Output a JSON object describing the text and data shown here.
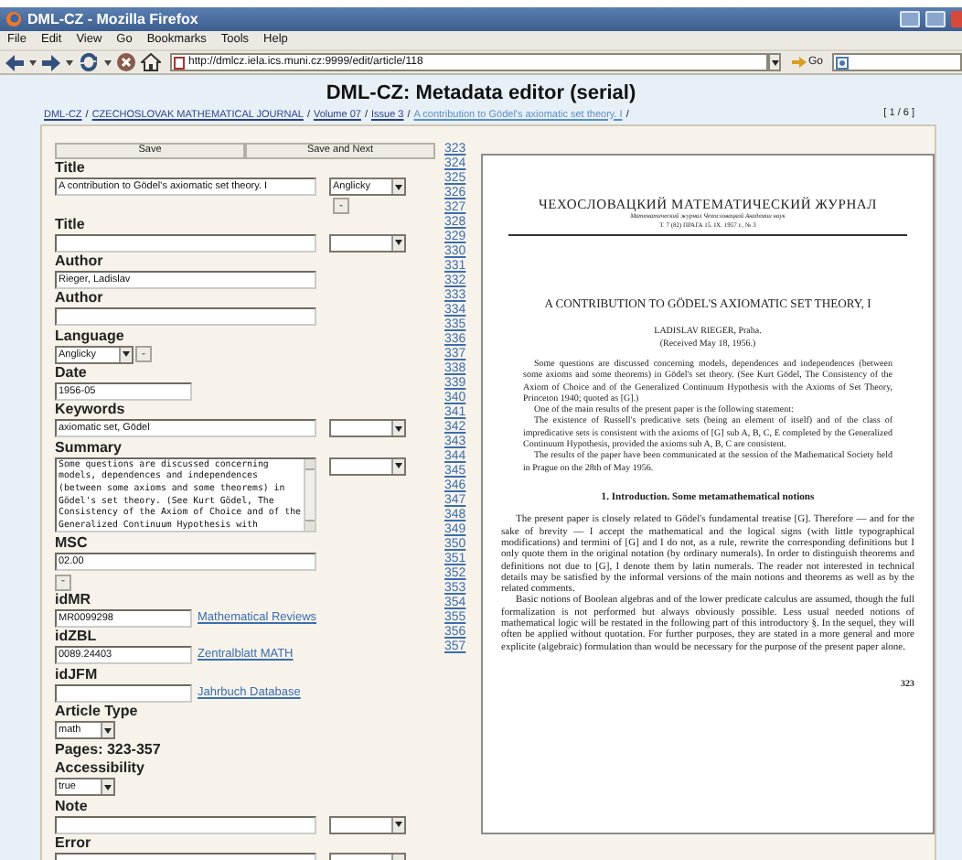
{
  "window": {
    "title": "DML-CZ - Mozilla Firefox"
  },
  "menu": [
    "File",
    "Edit",
    "View",
    "Go",
    "Bookmarks",
    "Tools",
    "Help"
  ],
  "toolbar": {
    "url": "http://dmlcz.iela.ics.muni.cz:9999/edit/article/118",
    "go": "Go"
  },
  "page": {
    "heading": "DML-CZ: Metadata editor (serial)",
    "breadcrumbs": [
      {
        "text": "DML-CZ",
        "visited": false
      },
      {
        "text": "CZECHOSLOVAK MATHEMATICAL JOURNAL",
        "visited": false
      },
      {
        "text": "Volume 07",
        "visited": false
      },
      {
        "text": "Issue 3",
        "visited": false
      },
      {
        "text": "A contribution to Gödel's axiomatic set theory. I",
        "visited": true
      }
    ],
    "breadcrumb_separator": "/",
    "pager": "[ 1 / 6 ]"
  },
  "buttons": [
    "Save",
    "Save and Next"
  ],
  "fields": [
    {
      "label": "Title",
      "kind": "text-lang",
      "value": "A contribution to Gödel's axiomatic set theory. I",
      "language": "Anglicky",
      "remove": "-"
    },
    {
      "label": "Title",
      "kind": "text-lang"
    },
    {
      "label": "Author",
      "kind": "text",
      "value": "Rieger, Ladislav"
    },
    {
      "label": "Author",
      "kind": "text"
    },
    {
      "label": "Language",
      "kind": "select",
      "value": "Anglicky",
      "remove": "-"
    },
    {
      "label": "Date",
      "kind": "short",
      "value": "1956-05"
    },
    {
      "label": "Keywords",
      "kind": "text-lang",
      "value": "axiomatic set, Gödel"
    },
    {
      "label": "Summary",
      "kind": "textarea-lang",
      "value": "Some questions are discussed concerning models, dependences and independences (between some axioms and some theorems) in Gödel's set theory. (See Kurt Gödel, The Consistency of the Axiom of Choice and of the Generalized Continuum Hypothesis with"
    },
    {
      "label": "MSC",
      "kind": "text",
      "value": "02.00",
      "remove": "-"
    },
    {
      "label": "idMR",
      "kind": "short-link",
      "value": "MR0099298",
      "link": "Mathematical Reviews"
    },
    {
      "label": "idZBL",
      "kind": "short-link",
      "value": "0089.24403",
      "link": "Zentralblatt MATH"
    },
    {
      "label": "idJFM",
      "kind": "short-link",
      "link": "Jahrbuch Database"
    },
    {
      "label": "Article Type",
      "kind": "select-small",
      "value": "math"
    },
    {
      "label": "Pages: 323-357",
      "kind": "static"
    },
    {
      "label": "Accessibility",
      "kind": "select-small",
      "value": "true"
    },
    {
      "label": "Note",
      "kind": "text-lang"
    },
    {
      "label": "Error",
      "kind": "text-lang"
    }
  ],
  "page_numbers": [
    "323",
    "324",
    "325",
    "326",
    "327",
    "328",
    "329",
    "330",
    "331",
    "332",
    "333",
    "334",
    "335",
    "336",
    "337",
    "338",
    "339",
    "340",
    "341",
    "342",
    "343",
    "344",
    "345",
    "346",
    "347",
    "348",
    "349",
    "350",
    "351",
    "352",
    "353",
    "354",
    "355",
    "356",
    "357"
  ],
  "document": {
    "journal": "ЧЕХОСЛОВАЦКИЙ МАТЕМАТИЧЕСКИЙ ЖУРНАЛ",
    "journal_subtitle": "Математический журнал Чехословацкой Академии наук",
    "issue": "Т. 7 (82) ПРАГА 15. IX. 1957 г., № 3",
    "title": "A CONTRIBUTION TO GÖDEL'S AXIOMATIC SET THEORY, I",
    "author": "LADISLAV RIEGER, Praha.",
    "received": "(Received May 18, 1956.)",
    "abstract": [
      "Some questions are discussed concerning models, dependences and independences (between some axioms and some theorems) in Gödel's set theory. (See Kurt Gödel, The Consistency of the Axiom of Choice and of the Generalized Continuum Hypothesis with the Axioms of Set Theory, Princeton 1940; quoted as [G].)",
      "One of the main results of the present paper is the following statement:",
      "The existence of Russell's predicative sets (being an element of itself) and of the class of impredicative sets is consistent with the axioms of [G] sub A, B, C, E completed by the Generalized Continuum Hypothesis, provided the axioms sub A, B, C are consistent.",
      "The results of the paper have been communicated at the session of the Mathematical Society held in Prague on the 28th of May 1956."
    ],
    "section": "1. Introduction. Some metamathematical notions",
    "body": [
      "The present paper is closely related to Gödel's fundamental treatise [G]. Therefore — and for the sake of brevity — I accept the mathematical and the logical signs (with little typographical modifications) and termini of [G] and I do not, as a rule, rewrite the corresponding definitions but I only quote them in the original notation (by ordinary numerals). In order to distinguish theorems and definitions not due to [G], I denote them by latin numerals. The reader not interested in technical details may be satisfied by the informal versions of the main notions and theorems as well as by the related comments.",
      "Basic notions of Boolean algebras and of the lower predicate calculus are assumed, though the full formalization is not performed but always obviously possible. Less usual needed notions of mathematical logic will be restated in the following part of this introductory §. In the sequel, they will often be applied without quotation. For further purposes, they are stated in a more general and more explicite (algebraic) formulation than would be necessary for the purpose of the present paper alone."
    ],
    "page_number": "323"
  }
}
